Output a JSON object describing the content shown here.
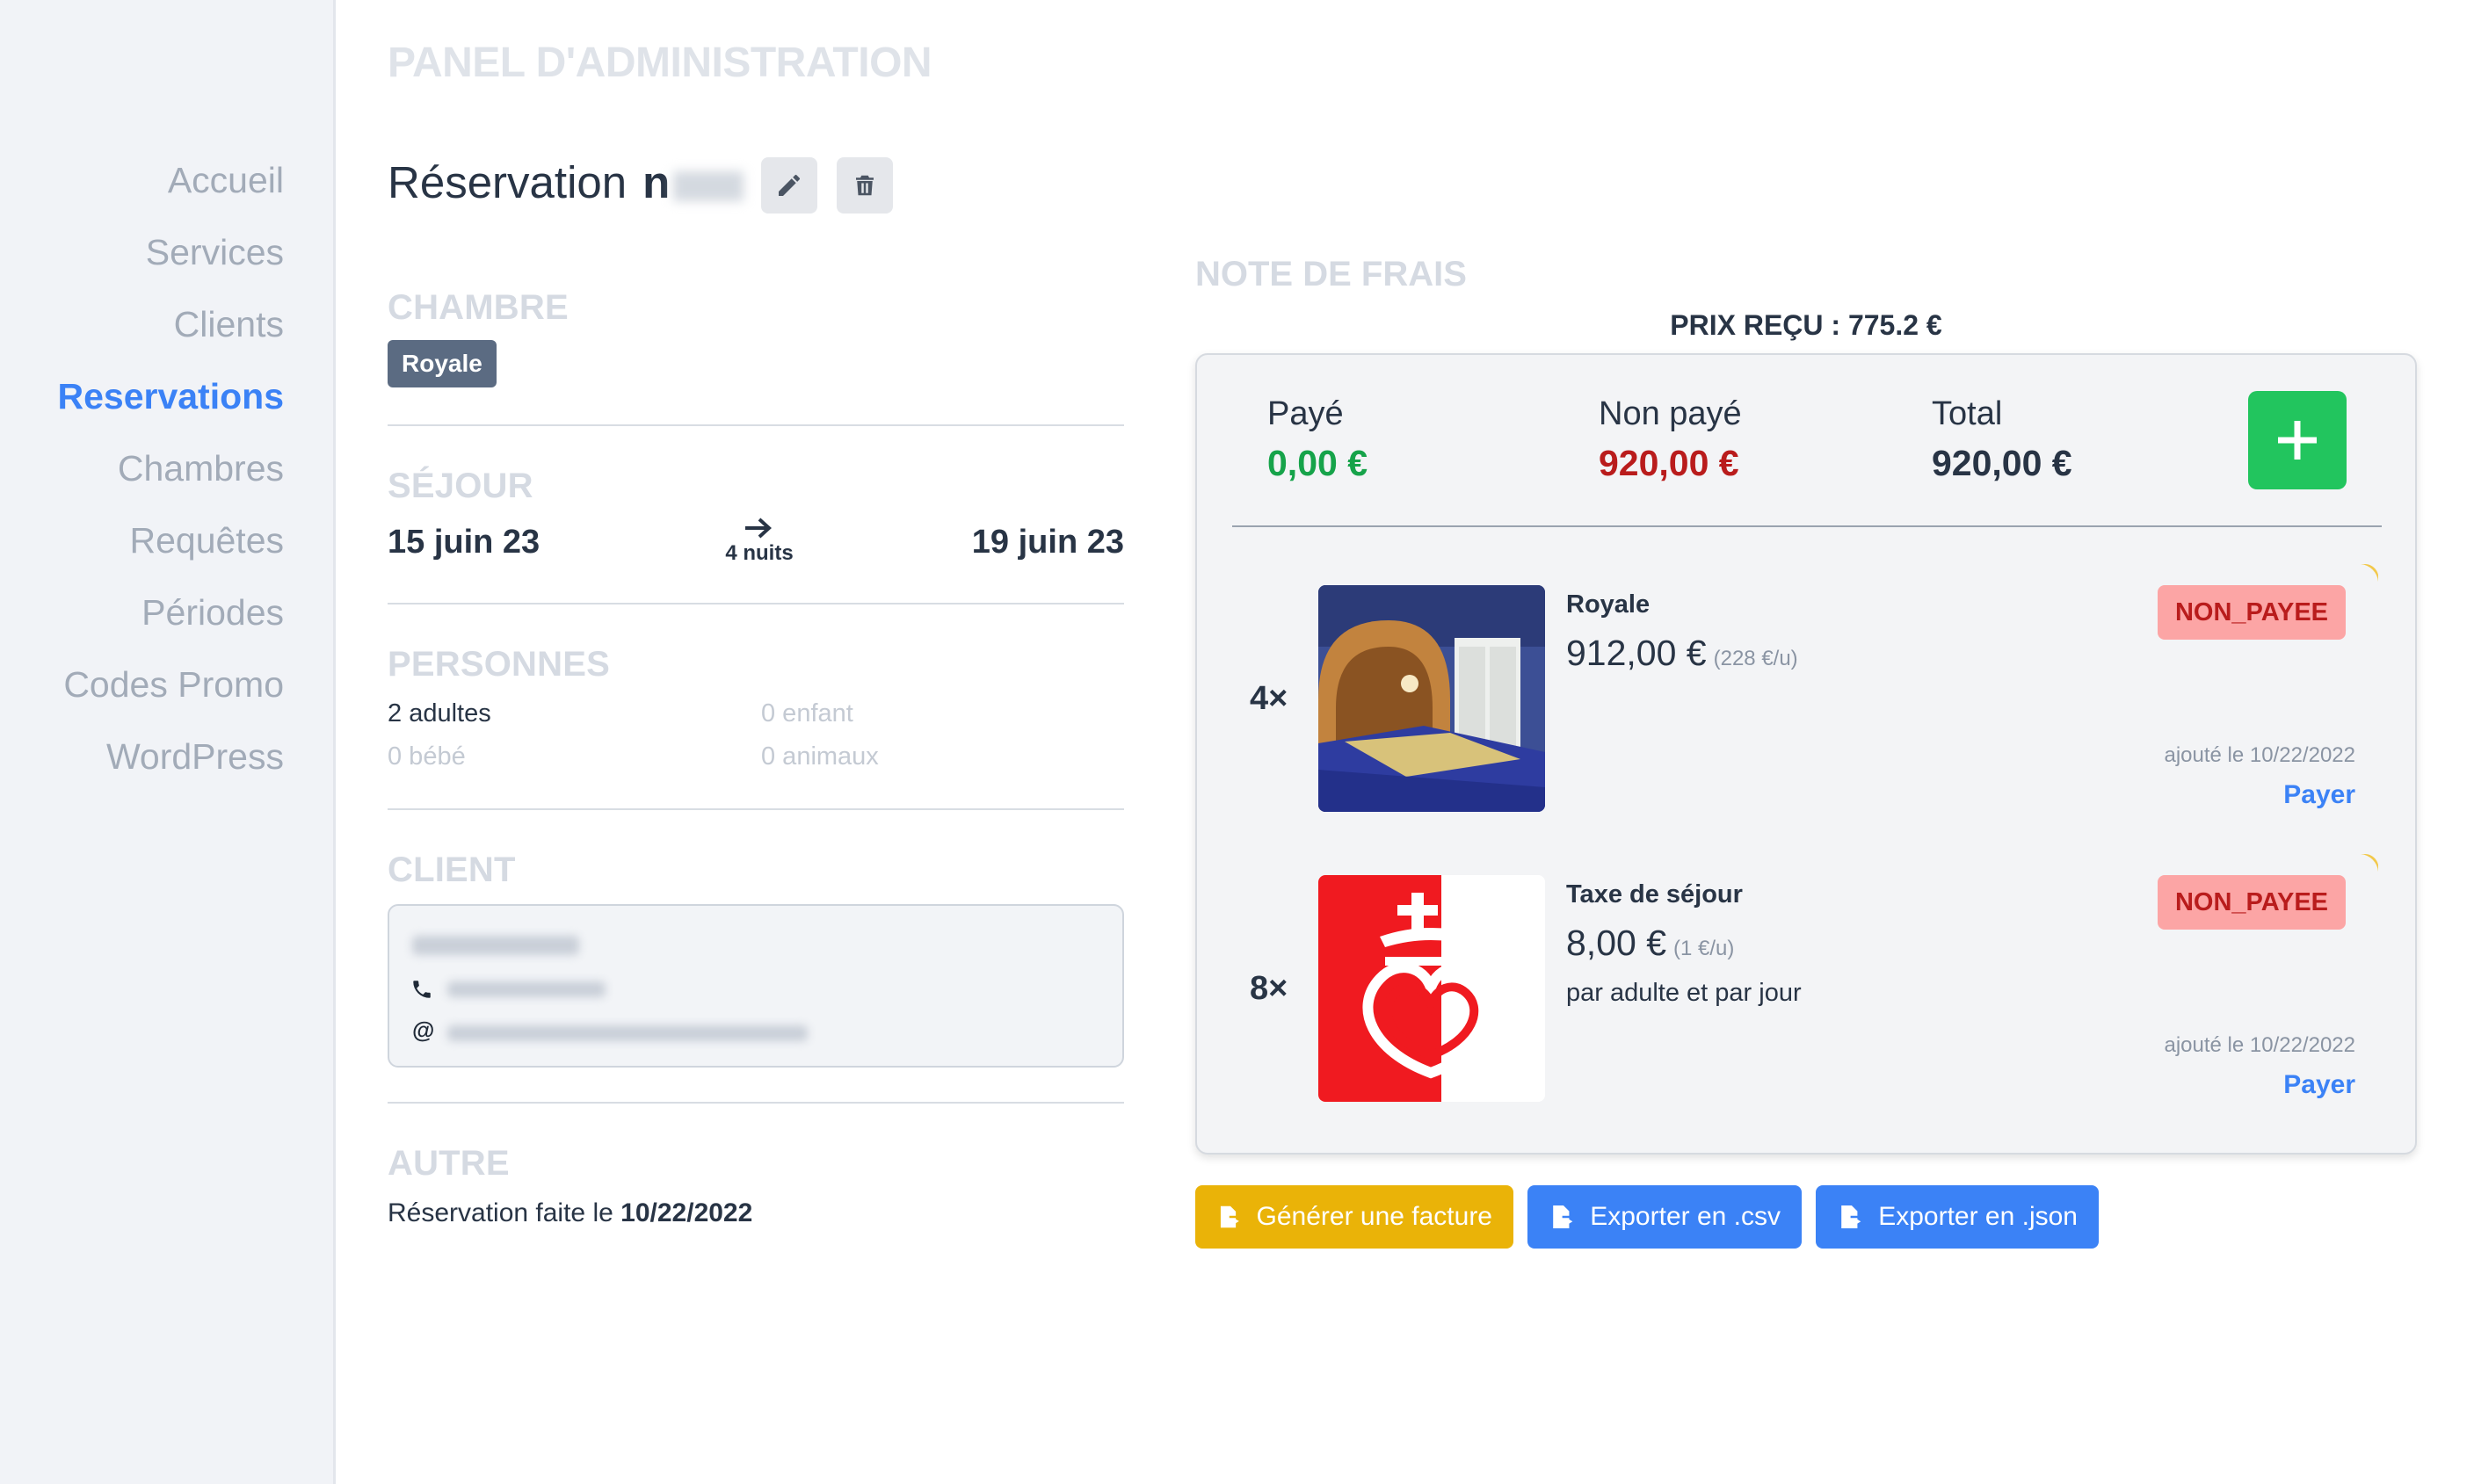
{
  "sidebar": {
    "items": [
      {
        "label": "Accueil"
      },
      {
        "label": "Services"
      },
      {
        "label": "Clients"
      },
      {
        "label": "Reservations",
        "active": true
      },
      {
        "label": "Chambres"
      },
      {
        "label": "Requêtes"
      },
      {
        "label": "Périodes"
      },
      {
        "label": "Codes Promo"
      },
      {
        "label": "WordPress"
      }
    ]
  },
  "header": {
    "title": "PANEL D'ADMINISTRATION"
  },
  "reservation": {
    "title": "Réservation",
    "number_prefix": "n"
  },
  "chambre": {
    "heading": "CHAMBRE",
    "room": "Royale"
  },
  "sejour": {
    "heading": "SÉJOUR",
    "start": "15 juin 23",
    "end": "19 juin 23",
    "nights": "4 nuits"
  },
  "personnes": {
    "heading": "PERSONNES",
    "adults_count": "2",
    "adults_label": "adultes",
    "children": "0 enfant",
    "babies": "0 bébé",
    "animals": "0 animaux"
  },
  "client": {
    "heading": "CLIENT"
  },
  "autre": {
    "heading": "AUTRE",
    "text": "Réservation faite le",
    "date": "10/22/2022"
  },
  "note": {
    "heading": "NOTE DE FRAIS",
    "prix_recu": "PRIX REÇU : 775.2 €",
    "paid_label": "Payé",
    "paid_value": "0,00 €",
    "unpaid_label": "Non payé",
    "unpaid_value": "920,00 €",
    "total_label": "Total",
    "total_value": "920,00 €",
    "items": [
      {
        "qty": "4×",
        "name": "Royale",
        "price": "912,00 €",
        "unit": "(228 €/u)",
        "desc": "",
        "status": "NON_PAYEE",
        "added": "ajouté le 10/22/2022",
        "pay": "Payer"
      },
      {
        "qty": "8×",
        "name": "Taxe de séjour",
        "price": "8,00 €",
        "unit": "(1 €/u)",
        "desc": "par adulte et par jour",
        "status": "NON_PAYEE",
        "added": "ajouté le 10/22/2022",
        "pay": "Payer"
      }
    ]
  },
  "actions": {
    "invoice": "Générer une facture",
    "csv": "Exporter en .csv",
    "json": "Exporter en .json"
  },
  "colors": {
    "accent": "#3b82f6",
    "paid": "#16a34a",
    "unpaid": "#b91c1c",
    "add": "#22c55e",
    "invoice": "#eab308",
    "export": "#3b82f6",
    "status_bg": "#fca5a5"
  }
}
